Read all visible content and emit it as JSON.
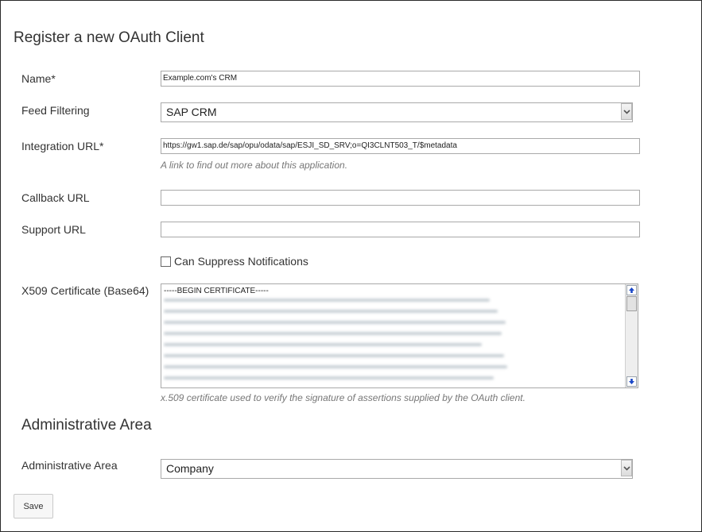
{
  "page": {
    "title": "Register a new OAuth Client"
  },
  "form": {
    "name": {
      "label": "Name*",
      "value": "Example.com's CRM"
    },
    "feed_filtering": {
      "label": "Feed Filtering",
      "selected": "SAP CRM"
    },
    "integration_url": {
      "label": "Integration URL*",
      "value": "https://gw1.sap.de/sap/opu/odata/sap/ESJI_SD_SRV;o=QI3CLNT503_T/$metadata",
      "hint": "A link to find out more about this application."
    },
    "callback_url": {
      "label": "Callback URL",
      "value": ""
    },
    "support_url": {
      "label": "Support URL",
      "value": ""
    },
    "suppress_notifications": {
      "label": "Can Suppress Notifications",
      "checked": false
    },
    "certificate": {
      "label": "X509 Certificate (Base64)",
      "first_line": "-----BEGIN CERTIFICATE-----",
      "hint": "x.509 certificate used to verify the signature of assertions supplied by the OAuth client."
    }
  },
  "admin": {
    "heading": "Administrative Area",
    "label": "Administrative Area",
    "selected": "Company"
  },
  "actions": {
    "save_label": "Save"
  },
  "icons": {
    "dropdown": "chevron-down-icon",
    "scroll_up": "arrow-up-icon",
    "scroll_down": "arrow-down-icon"
  },
  "colors": {
    "text": "#333333",
    "hint": "#777777",
    "border": "#a9a9a9",
    "scroll_arrow": "#1a47c8"
  }
}
